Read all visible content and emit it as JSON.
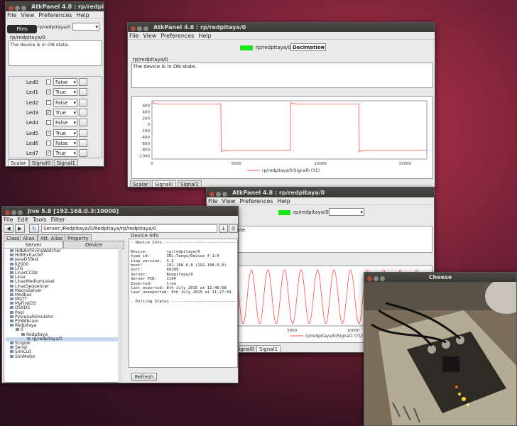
{
  "panel1": {
    "title": "AtkPanel  4.8  : rp/redpitaya/0",
    "menu": [
      "File",
      "View",
      "Preferences",
      "Help"
    ],
    "device": "rp/redpitaya/0",
    "state_text": "The device is in ON state.",
    "tooltip": "Files",
    "leds": [
      {
        "label": "Led0",
        "value": "False",
        "checked": false
      },
      {
        "label": "Led1",
        "value": "True",
        "checked": true
      },
      {
        "label": "Led2",
        "value": "False",
        "checked": false
      },
      {
        "label": "Led3",
        "value": "True",
        "checked": true
      },
      {
        "label": "Led4",
        "value": "False",
        "checked": false
      },
      {
        "label": "Led5",
        "value": "True",
        "checked": true
      },
      {
        "label": "Led6",
        "value": "False",
        "checked": false
      },
      {
        "label": "Led7",
        "value": "True",
        "checked": true
      }
    ],
    "tabs": [
      "Scalar",
      "Signal0",
      "Signal1"
    ]
  },
  "panel2": {
    "title": "AtkPanel  4.8  : rp/redpitaya/0",
    "menu": [
      "File",
      "View",
      "Preferences",
      "Help"
    ],
    "device": "rp/redpitaya/0",
    "mode": "Decimation",
    "state_text": "The device is in ON state.",
    "tabs": [
      "Scalar",
      "Signal0",
      "Signal1"
    ],
    "legend": "rp/redpitaya/0/Signal0 (Y1)",
    "chart_data": {
      "type": "line",
      "x_ticks": [
        "0",
        "5000",
        "10000",
        "15000"
      ],
      "y_ticks": [
        "600",
        "400",
        "200",
        "0",
        "-200",
        "-400",
        "-600",
        "-800",
        "-1000"
      ],
      "xlim": [
        0,
        16300
      ],
      "ylim": [
        -1100,
        750
      ],
      "series": [
        {
          "name": "rp/redpitaya/0/Signal0 (Y1)",
          "color": "#ff4d4d",
          "period": 8200,
          "high": 650,
          "low": -820
        }
      ]
    }
  },
  "panel3": {
    "title": "AtkPanel  4.8  : rp/redpitaya/0",
    "menu": [
      "File",
      "View",
      "Preferences",
      "Help"
    ],
    "device": "rp/redpitaya/0",
    "state_text": "is in ON state.",
    "tabs": [
      "Signal0",
      "Signal1"
    ],
    "legend": "rp/redpitaya/0/Signal1 (Y1)",
    "chart_data": {
      "type": "line",
      "x_ticks": [
        "5000",
        "10000",
        "15000"
      ],
      "xlim": [
        -1500,
        16300
      ],
      "series": [
        {
          "name": "rp/redpitaya/0/Signal1 (Y1)",
          "color": "#ff4d4d",
          "period": 1350
        }
      ]
    }
  },
  "jive": {
    "title": "Jive 5.8  [192.168.0.3:10000]",
    "menu": [
      "File",
      "Edit",
      "Tools",
      "Filter"
    ],
    "path": "Server:/Redpitaya/0/Redpitaya/rp/redpitaya/0",
    "tabs": [
      "Class",
      "Alias",
      "Att. Alias",
      "Property"
    ],
    "subtabs": [
      "Server",
      "Device"
    ],
    "tree": [
      "HdbArchivingWatcher",
      "HdbExtractor",
      "JavaDSTest",
      "K2000",
      "LFG",
      "LinacCCDs",
      "Linac",
      "LinacMediumLevel",
      "LinacSequencer",
      "MacroServer",
      "Modbus",
      "MQTT",
      "MyFirstDS",
      "OSXDS",
      "Pool",
      "PySignalSimulator",
      "PyWebcam",
      "Redpitaya",
      "0",
      "Redpitaya",
      "rp/redpitaya/0",
      "Scopok",
      "Serial",
      "SimCcd",
      "SimMotor"
    ],
    "info_title": "Device Info",
    "info": [
      "- Device Info -------------------------------",
      "",
      "Device:        rp/redpitaya/0",
      "type_id:       IDL:Tango/Device_4_1:0",
      "iiop_version:  1.2",
      "host:          192.168.0.8 (192.168.0.8)",
      "port:          40289",
      "Server:        Redpitaya/0",
      "Server PID:    1194",
      "Exported:      true",
      "last_exported: 8th July 2015 at 11:46:58",
      "last_unexported: 8th July 2015 at 11:27:34",
      "",
      "- Polling Status ----------------------------"
    ],
    "refresh": "Refresh"
  },
  "cheese": {
    "title": "Cheese"
  }
}
